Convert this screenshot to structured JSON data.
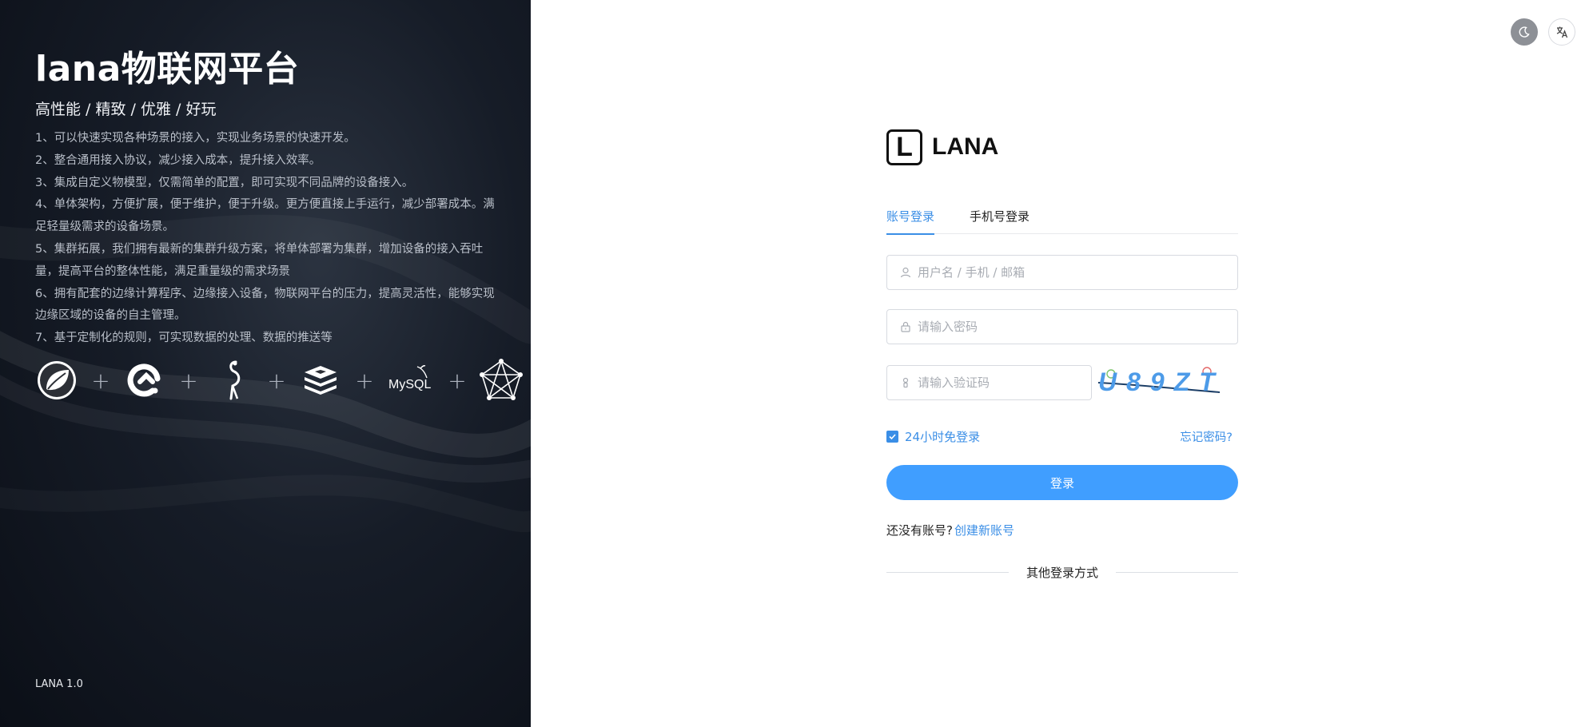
{
  "hero": {
    "title": "lana物联网平台",
    "subtitle": "高性能 / 精致 / 优雅 / 好玩",
    "features": [
      "1、可以快速实现各种场景的接入，实现业务场景的快速开发。",
      "2、整合通用接入协议，减少接入成本，提升接入效率。",
      "3、集成自定义物模型，仅需简单的配置，即可实现不同品牌的设备接入。",
      "4、单体架构，方便扩展，便于维护，便于升级。更方便直接上手运行，减少部署成本。满足轻量级需求的设备场景。",
      "5、集群拓展，我们拥有最新的集群升级方案，将单体部署为集群，增加设备的接入吞吐量，提高平台的整体性能，满足重量级的需求场景",
      "6、拥有配套的边缘计算程序、边缘接入设备，物联网平台的压力，提高灵活性，能够实现边缘区域的设备的自主管理。",
      "7、基于定制化的规则，可实现数据的处理、数据的推送等"
    ],
    "tech_icons": [
      "spring-leaf-icon",
      "eclipse-vertx-icon",
      "flamingo-icon",
      "redis-icon",
      "mysql-icon",
      "network-pentagon-icon"
    ],
    "tech_plus": "+",
    "mysql_text": "MySQL",
    "version": "LANA 1.0"
  },
  "tools": {
    "theme_icon": "moon-icon",
    "lang_icon": "translate-icon"
  },
  "brand": {
    "logo_letter": "L",
    "name": "LANA"
  },
  "tabs": [
    {
      "label": "账号登录",
      "active": true
    },
    {
      "label": "手机号登录",
      "active": false
    }
  ],
  "form": {
    "username_placeholder": "用户名 / 手机 / 邮箱",
    "password_placeholder": "请输入密码",
    "code_placeholder": "请输入验证码",
    "captcha_text": "U89ZT",
    "remember_label": "24小时免登录",
    "remember_checked": true,
    "forgot_label": "忘记密码?",
    "login_label": "登录",
    "signup_prompt": "还没有账号?",
    "signup_link": "创建新账号",
    "other_login": "其他登录方式"
  },
  "colors": {
    "accent": "#409eff",
    "link": "#3a8ee6",
    "hero_bg": "#121824"
  }
}
